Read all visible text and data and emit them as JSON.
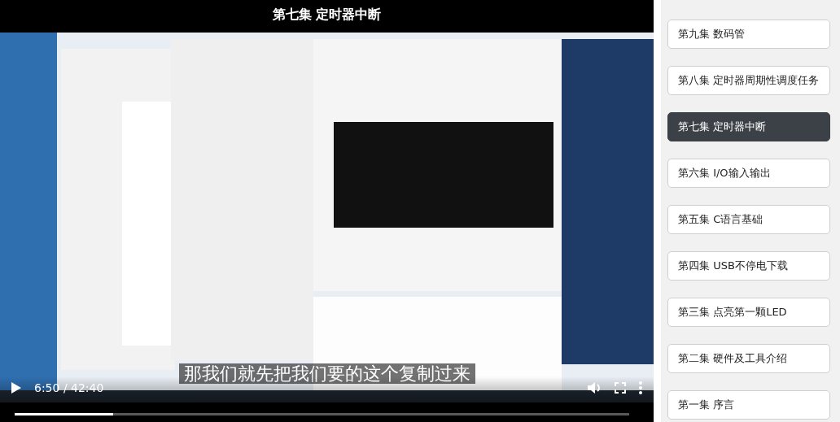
{
  "video": {
    "title": "第七集 定时器中断",
    "caption": "那我们就先把我们要的这个复制过来",
    "controls": {
      "playing": false,
      "time": "6:50 / 42:40",
      "progress": {
        "level": 0.16
      }
    }
  },
  "playlist": [
    {
      "label": "第九集 数码管",
      "selected": false
    },
    {
      "label": "第八集 定时器周期性调度任务",
      "selected": false
    },
    {
      "label": "第七集 定时器中断",
      "selected": true
    },
    {
      "label": "第六集 I/O输入输出",
      "selected": false
    },
    {
      "label": "第五集 C语言基础",
      "selected": false
    },
    {
      "label": "第四集 USB不停电下载",
      "selected": false
    },
    {
      "label": "第三集 点亮第一颗LED",
      "selected": false
    },
    {
      "label": "第二集 硬件及工具介绍",
      "selected": false
    },
    {
      "label": "第一集 序言",
      "selected": false
    }
  ]
}
